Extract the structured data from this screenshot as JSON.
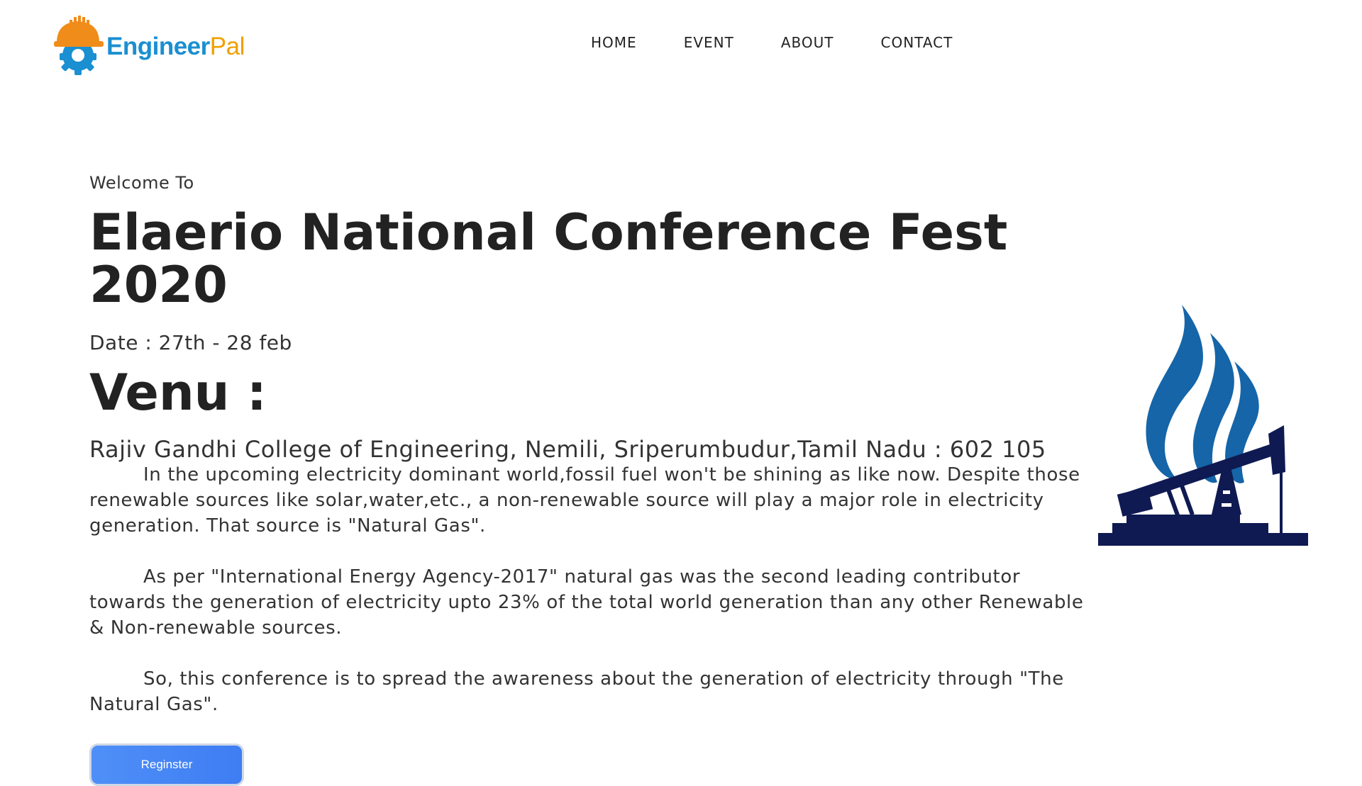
{
  "header": {
    "logo": {
      "word1": "Engineer",
      "word2": "Pal"
    },
    "nav": [
      {
        "label": "HOME"
      },
      {
        "label": "EVENT"
      },
      {
        "label": "ABOUT"
      },
      {
        "label": "CONTACT"
      }
    ]
  },
  "hero": {
    "welcome": "Welcome To",
    "title": "Elaerio National Conference Fest 2020",
    "date": "Date : 27th - 28 feb",
    "venue_label": "Venu :",
    "venue": "Rajiv Gandhi College of Engineering, Nemili, Sriperumbudur,Tamil Nadu : 602 105"
  },
  "description": {
    "paragraphs": [
      "In the upcoming electricity dominant world,fossil fuel won't be shining as like now. Despite those renewable sources like solar,water,etc., a non-renewable source will play a major role in electricity generation. That source is \"Natural Gas\".",
      "As per \"International Energy Agency-2017\" natural gas was the second leading contributor towards the generation of electricity upto 23% of the total world generation than any other Renewable & Non-renewable sources.",
      "So, this conference is to spread the awareness about the generation of electricity through \"The Natural Gas\"."
    ]
  },
  "register_button": {
    "label": "Reginster"
  },
  "colors": {
    "logo_blue": "#1a8fd1",
    "logo_orange": "#f0a000",
    "button_blue": "#4f8ff7",
    "flame_blue": "#1565a8",
    "pump_navy": "#0f1a52"
  },
  "icons": {
    "logo": "engineer-helmet-gear-icon",
    "illustration": "natural-gas-flame-pump-icon"
  }
}
